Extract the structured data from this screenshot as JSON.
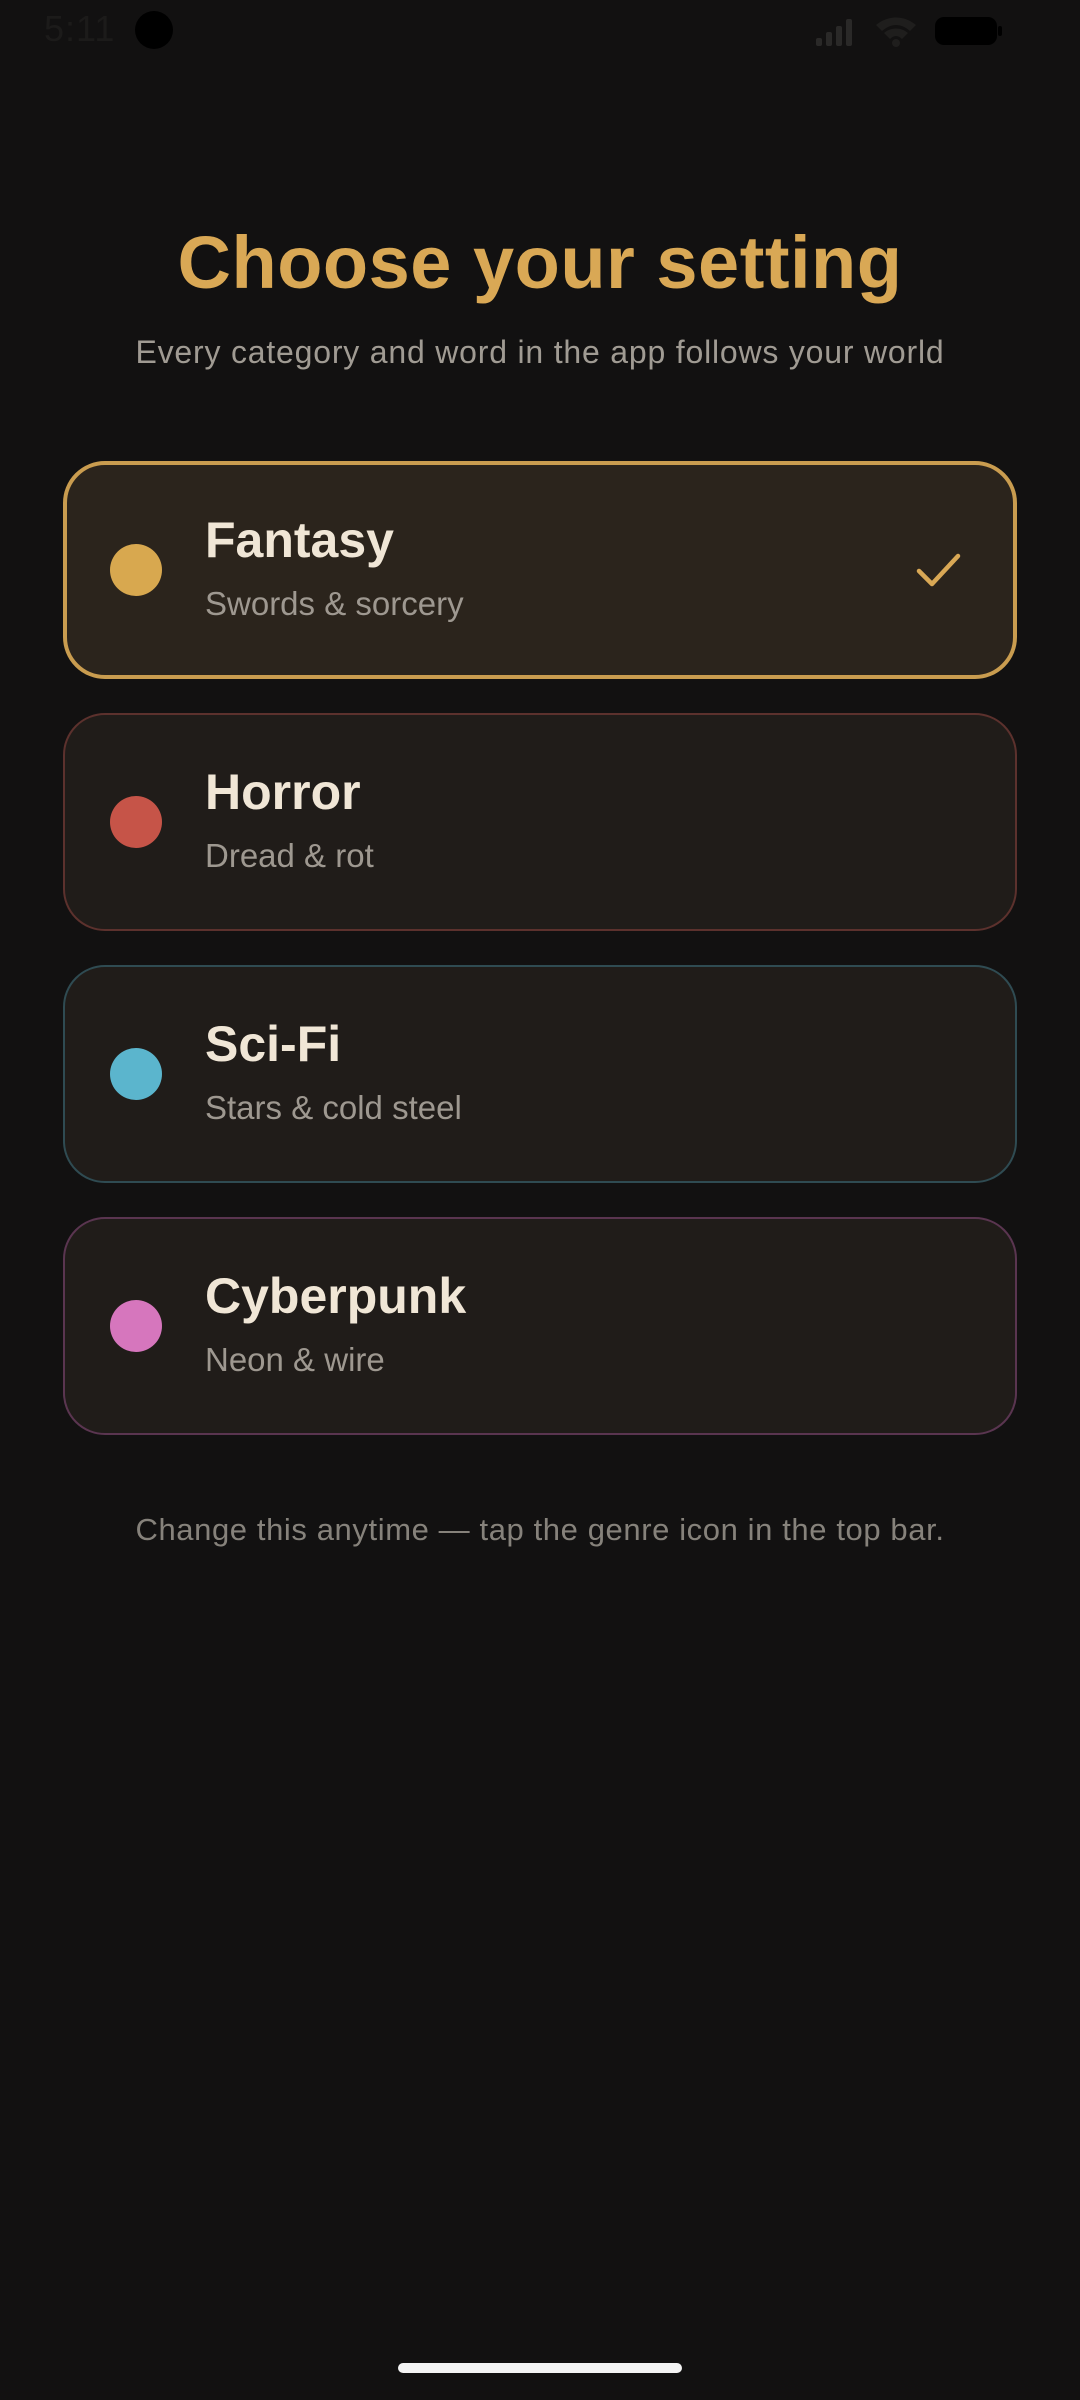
{
  "status_bar": {
    "time": "5:11",
    "icons": [
      "signal-icon",
      "wifi-icon",
      "battery-icon"
    ]
  },
  "header": {
    "title": "Choose your setting",
    "subtitle": "Every category and word in the app follows your world"
  },
  "genres": [
    {
      "key": "fantasy",
      "name": "Fantasy",
      "tagline": "Swords & sorcery",
      "color": "#d8a84f",
      "selected": true
    },
    {
      "key": "horror",
      "name": "Horror",
      "tagline": "Dread & rot",
      "color": "#c65448",
      "selected": false
    },
    {
      "key": "scifi",
      "name": "Sci-Fi",
      "tagline": "Stars & cold steel",
      "color": "#5bb5cd",
      "selected": false
    },
    {
      "key": "cyberpunk",
      "name": "Cyberpunk",
      "tagline": "Neon & wire",
      "color": "#d676bd",
      "selected": false
    }
  ],
  "footnote": "Change this anytime — tap the genre icon in the top bar.",
  "colors": {
    "accent": "#d9a855",
    "background": "#121111",
    "card": "#201c19",
    "selected_card": "#2b241c"
  }
}
